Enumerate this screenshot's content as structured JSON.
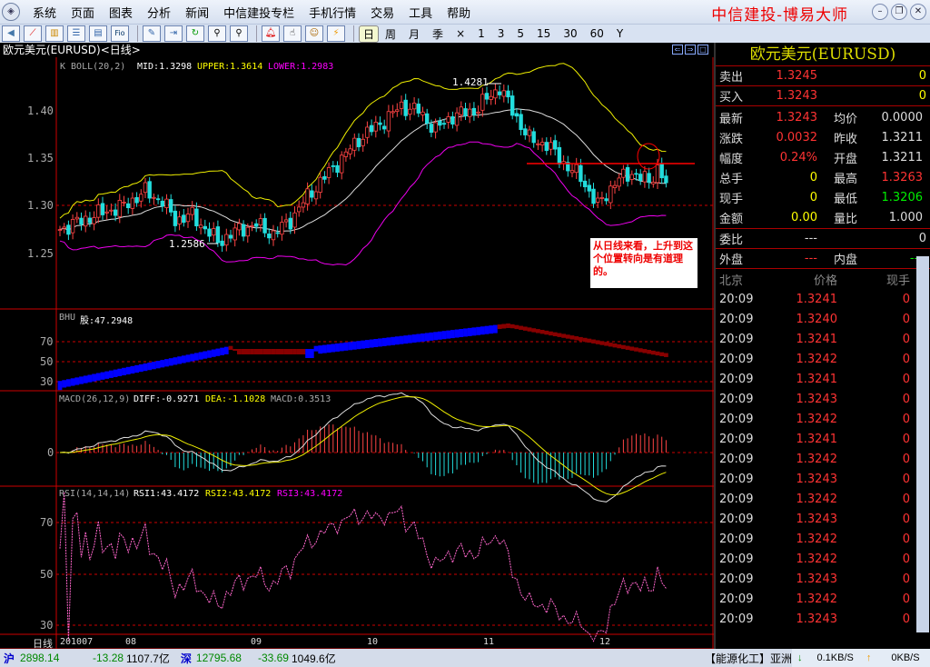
{
  "menu": {
    "items": [
      "系统",
      "页面",
      "图表",
      "分析",
      "新闻",
      "中信建投专栏",
      "手机行情",
      "交易",
      "工具",
      "帮助"
    ],
    "brand": "中信建投-博易大师"
  },
  "toolbar": {
    "periods": [
      "日",
      "周",
      "月",
      "季",
      "×",
      "1",
      "3",
      "5",
      "15",
      "30",
      "60",
      "Y"
    ],
    "active": "日",
    "icons": [
      "back-icon",
      "line-chart-icon",
      "kline-icon",
      "list-icon",
      "report-icon",
      "fio-icon",
      "edit-icon",
      "export-icon",
      "refresh-icon",
      "zoom-in-icon",
      "zoom-out-icon",
      "alarm-icon",
      "pointer-icon",
      "users-icon",
      "lightning-icon"
    ]
  },
  "chart": {
    "title": "欧元美元(EURUSD)<日线>",
    "boll_label": "K   BOLL(20,2)",
    "mid": "MID:1.3298",
    "upper": "UPPER:1.3614",
    "lower": "LOWER:1.2983",
    "high_mark": "1.4281",
    "low_mark": "1.2586",
    "price_ticks": [
      "1.40",
      "1.35",
      "1.30",
      "1.25"
    ],
    "bhu_label": "BHU",
    "bhu_value": "股:47.2948",
    "bhu_ticks": [
      "70",
      "50",
      "30"
    ],
    "macd_label": "MACD(26,12,9)",
    "diff": "DIFF:-0.9271",
    "dea": "DEA:-1.1028",
    "macd": "MACD:0.3513",
    "macd_ticks": [
      "0"
    ],
    "rsi_label": "RSI(14,14,14)",
    "rsi1": "RSI1:43.4172",
    "rsi2": "RSI2:43.4172",
    "rsi3": "RSI3:43.4172",
    "rsi_ticks": [
      "70",
      "50",
      "30"
    ],
    "period_label": "日线",
    "x_labels": [
      "201007",
      "08",
      "09",
      "10",
      "11",
      "12"
    ],
    "note": "从日线来看，上升到这个位置转向是有道理的。"
  },
  "chart_data": {
    "type": "candlestick",
    "title": "欧元美元(EURUSD) 日线",
    "ylim": [
      1.2,
      1.45
    ],
    "close_keypoints": [
      [
        0,
        1.275
      ],
      [
        8,
        1.29
      ],
      [
        15,
        1.3
      ],
      [
        20,
        1.315
      ],
      [
        24,
        1.305
      ],
      [
        27,
        1.285
      ],
      [
        31,
        1.29
      ],
      [
        37,
        1.262
      ],
      [
        42,
        1.275
      ],
      [
        46,
        1.28
      ],
      [
        50,
        1.27
      ],
      [
        54,
        1.285
      ],
      [
        58,
        1.31
      ],
      [
        64,
        1.34
      ],
      [
        70,
        1.37
      ],
      [
        76,
        1.39
      ],
      [
        80,
        1.405
      ],
      [
        84,
        1.4
      ],
      [
        88,
        1.38
      ],
      [
        92,
        1.395
      ],
      [
        97,
        1.4
      ],
      [
        103,
        1.425
      ],
      [
        106,
        1.4
      ],
      [
        110,
        1.37
      ],
      [
        114,
        1.365
      ],
      [
        118,
        1.345
      ],
      [
        122,
        1.33
      ],
      [
        126,
        1.3
      ],
      [
        130,
        1.325
      ],
      [
        134,
        1.335
      ],
      [
        138,
        1.325
      ],
      [
        140,
        1.34
      ],
      [
        142,
        1.3243
      ]
    ]
  },
  "quote": {
    "title": "欧元美元(EURUSD)",
    "sell": {
      "label": "卖出",
      "price": "1.3245",
      "vol": "0"
    },
    "buy": {
      "label": "买入",
      "price": "1.3243",
      "vol": "0"
    },
    "rows": [
      {
        "k1": "最新",
        "v1": "1.3243",
        "k2": "均价",
        "v2": "0.0000"
      },
      {
        "k1": "涨跌",
        "v1": "0.0032",
        "k2": "昨收",
        "v2": "1.3211"
      },
      {
        "k1": "幅度",
        "v1": "0.24%",
        "k2": "开盘",
        "v2": "1.3211"
      },
      {
        "k1": "总手",
        "v1": "0",
        "k2": "最高",
        "v2": "1.3263"
      },
      {
        "k1": "现手",
        "v1": "0",
        "k2": "最低",
        "v2": "1.3206"
      },
      {
        "k1": "金额",
        "v1": "0.00",
        "k2": "量比",
        "v2": "1.000"
      }
    ],
    "weibi": {
      "label": "委比",
      "v1": "---",
      "v2": "0"
    },
    "outer": {
      "label": "外盘",
      "value": "---",
      "label2": "内盘",
      "value2": "---"
    },
    "tick_headers": [
      "北京",
      "价格",
      "现手"
    ],
    "ticks": [
      [
        "20:09",
        "1.3241",
        "0"
      ],
      [
        "20:09",
        "1.3240",
        "0"
      ],
      [
        "20:09",
        "1.3241",
        "0"
      ],
      [
        "20:09",
        "1.3242",
        "0"
      ],
      [
        "20:09",
        "1.3241",
        "0"
      ],
      [
        "20:09",
        "1.3243",
        "0"
      ],
      [
        "20:09",
        "1.3242",
        "0"
      ],
      [
        "20:09",
        "1.3241",
        "0"
      ],
      [
        "20:09",
        "1.3242",
        "0"
      ],
      [
        "20:09",
        "1.3243",
        "0"
      ],
      [
        "20:09",
        "1.3242",
        "0"
      ],
      [
        "20:09",
        "1.3243",
        "0"
      ],
      [
        "20:09",
        "1.3242",
        "0"
      ],
      [
        "20:09",
        "1.3242",
        "0"
      ],
      [
        "20:09",
        "1.3243",
        "0"
      ],
      [
        "20:09",
        "1.3242",
        "0"
      ],
      [
        "20:09",
        "1.3243",
        "0"
      ]
    ]
  },
  "status": {
    "sh_label": "沪",
    "sh_index": "2898.14",
    "sh_change": "-13.28",
    "sh_amount": "1107.7亿",
    "sz_label": "深",
    "sz_index": "12795.68",
    "sz_change": "-33.69",
    "sz_amount": "1049.6亿",
    "news": "【能源化工】亚洲概",
    "down_speed": "0.1KB/S",
    "up_speed": "0KB/S"
  }
}
